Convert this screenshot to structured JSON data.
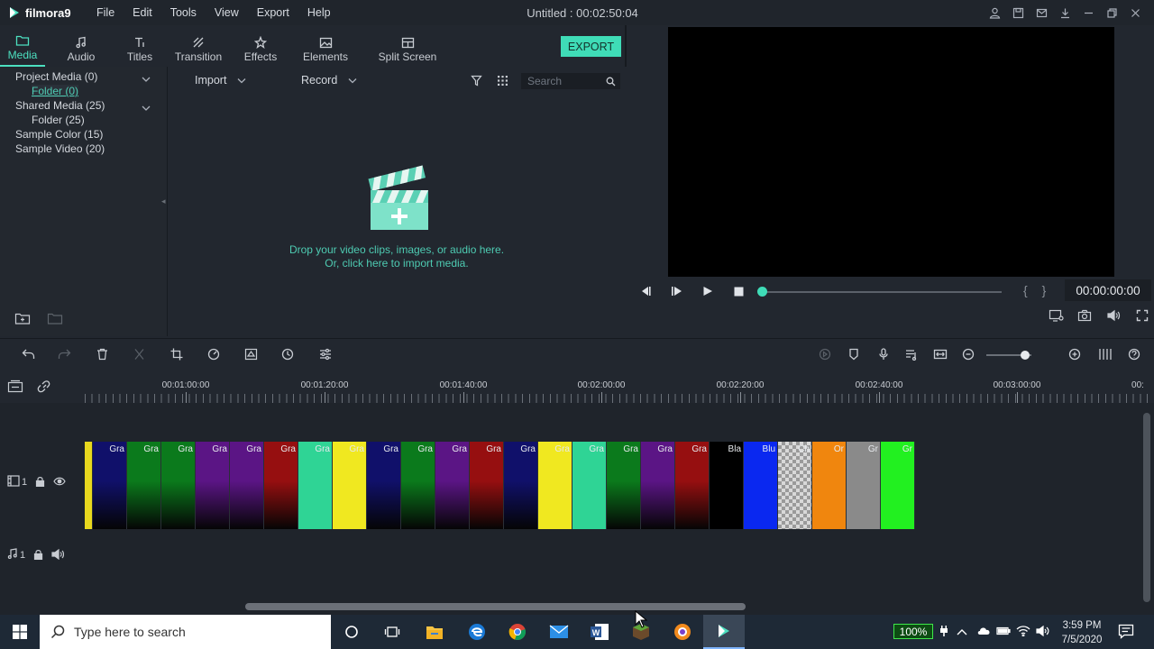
{
  "app": {
    "name": "filmora9",
    "title": "Untitled : 00:02:50:04"
  },
  "menu": [
    "File",
    "Edit",
    "Tools",
    "View",
    "Export",
    "Help"
  ],
  "tabs": [
    {
      "label": "Media",
      "icon": "folder-icon",
      "active": true
    },
    {
      "label": "Audio",
      "icon": "music-note-icon"
    },
    {
      "label": "Titles",
      "icon": "titles-icon"
    },
    {
      "label": "Transition",
      "icon": "transition-icon"
    },
    {
      "label": "Effects",
      "icon": "effects-icon"
    },
    {
      "label": "Elements",
      "icon": "image-icon"
    },
    {
      "label": "Split Screen",
      "icon": "split-screen-icon"
    }
  ],
  "export_label": "EXPORT",
  "tree": {
    "project_media": "Project Media (0)",
    "project_folder": "Folder (0)",
    "shared_media": "Shared Media (25)",
    "shared_folder": "Folder (25)",
    "sample_color": "Sample Color (15)",
    "sample_video": "Sample Video (20)"
  },
  "media_toolbar": {
    "import": "Import",
    "record": "Record",
    "search_placeholder": "Search"
  },
  "drop": {
    "line1": "Drop your video clips, images, or audio here.",
    "line2": "Or, click here to import media."
  },
  "preview": {
    "timecode": "00:00:00:00",
    "brackets": "{ }",
    "progress": 0
  },
  "ruler": [
    "00:01:00:00",
    "00:01:20:00",
    "00:01:40:00",
    "00:02:00:00",
    "00:02:20:00",
    "00:02:40:00",
    "00:03:00:00",
    "00:"
  ],
  "tracks": {
    "video_num": "1",
    "audio_num": "1"
  },
  "clips": [
    {
      "label": "",
      "color": "#e8d81e"
    },
    {
      "label": "Gra",
      "color": "#10106a"
    },
    {
      "label": "Gra",
      "color": "#0b7a1c"
    },
    {
      "label": "Gra",
      "color": "#0b7a1c"
    },
    {
      "label": "Gra",
      "color": "#5b1585"
    },
    {
      "label": "Gra",
      "color": "#5b1585"
    },
    {
      "label": "Gra",
      "color": "#960f10"
    },
    {
      "label": "Gra",
      "color": "#2fd495"
    },
    {
      "label": "Gra",
      "color": "#f0e820"
    },
    {
      "label": "Gra",
      "color": "#10106a"
    },
    {
      "label": "Gra",
      "color": "#0b7a1c"
    },
    {
      "label": "Gra",
      "color": "#5b1585"
    },
    {
      "label": "Gra",
      "color": "#960f10"
    },
    {
      "label": "Gra",
      "color": "#10106a"
    },
    {
      "label": "Gra",
      "color": "#f0e820"
    },
    {
      "label": "Gra",
      "color": "#2fd495"
    },
    {
      "label": "Gra",
      "color": "#0b7a1c"
    },
    {
      "label": "Gra",
      "color": "#5b1585"
    },
    {
      "label": "Gra",
      "color": "#960f10"
    },
    {
      "label": "Bla",
      "color": "#000000"
    },
    {
      "label": "Blu",
      "color": "#0a28f0"
    },
    {
      "label": "Ch",
      "color": "checker"
    },
    {
      "label": "Or",
      "color": "#f0860e"
    },
    {
      "label": "Gr",
      "color": "#8a8a8a"
    },
    {
      "label": "Gr",
      "color": "#22f020"
    }
  ],
  "taskbar": {
    "search_placeholder": "Type here to search",
    "battery": "100%",
    "time": "3:59 PM",
    "date": "7/5/2020"
  }
}
